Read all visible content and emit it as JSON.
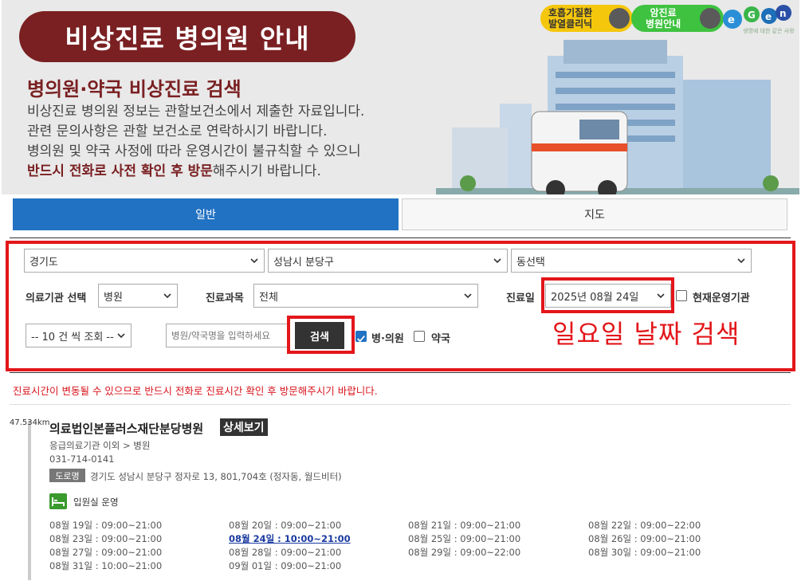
{
  "banner": {
    "title": "비상진료 병의원 안내",
    "subtitle": "병의원·약국 비상진료 검색",
    "desc_lines": [
      "비상진료 병의원 정보는 관할보건소에서 제출한 자료입니다.",
      "관련 문의사항은 관할 보건소로 연락하시기 바랍니다.",
      "병의원 및 약국 사정에 따라 운영시간이 불규칙할 수 있으니"
    ],
    "desc_emph": "반드시 전화로 사전 확인 후 방문",
    "desc_tail": "해주시기 바랍니다.",
    "btn_respiratory_1": "호흡기질환",
    "btn_respiratory_2": "발열클리닉",
    "btn_cancer_1": "암진료",
    "btn_cancer_2": "병원안내",
    "egen_tag": "생명에 대한 같은 사랑"
  },
  "tabs": {
    "general": "일반",
    "map": "지도"
  },
  "filters": {
    "province": "경기도",
    "district": "성남시 분당구",
    "dong": "동선택",
    "facility_label": "의료기관 선택",
    "facility_value": "병원",
    "dept_label": "진료과목",
    "dept_value": "전체",
    "date_label": "진료일",
    "date_value": "2025년 08월 24일",
    "open_now_label": "현재운영기관",
    "page_size": "-- 10 건 씩 조회 --",
    "name_placeholder": "병원/약국명을 입력하세요",
    "search_button": "검색",
    "hospital_check_label": "병·의원",
    "pharmacy_check_label": "약국"
  },
  "annotation": "일요일 날짜 검색",
  "notice": "진료시간이 변동될 수 있으므로 반드시 전화로 진료시간 확인 후 방문해주시기 바랍니다.",
  "result": {
    "distance": "47.534km",
    "name": "의료법인본플러스재단분당병원",
    "detail_button": "상세보기",
    "category": "응급의료기관 이외 > 병원",
    "phone": "031-714-0141",
    "road_badge": "도로명",
    "address": "경기도 성남시 분당구 정자로 13, 801,704호 (정자동, 월드비터)",
    "ward": "입원실 운영",
    "schedule": [
      [
        "08월 19일 : 09:00~21:00",
        "08월 20일 : 09:00~21:00",
        "08월 21일 : 09:00~21:00",
        "08월 22일 : 09:00~22:00"
      ],
      [
        "08월 23일 : 09:00~21:00",
        "08월 24일 : 10:00~21:00",
        "08월 25일 : 09:00~21:00",
        "08월 26일 : 09:00~21:00"
      ],
      [
        "08월 27일 : 09:00~21:00",
        "08월 28일 : 09:00~21:00",
        "08월 29일 : 09:00~22:00",
        "08월 30일 : 09:00~21:00"
      ],
      [
        "08월 31일 : 10:00~21:00",
        "09월 01일 : 09:00~21:00",
        "",
        ""
      ]
    ]
  }
}
